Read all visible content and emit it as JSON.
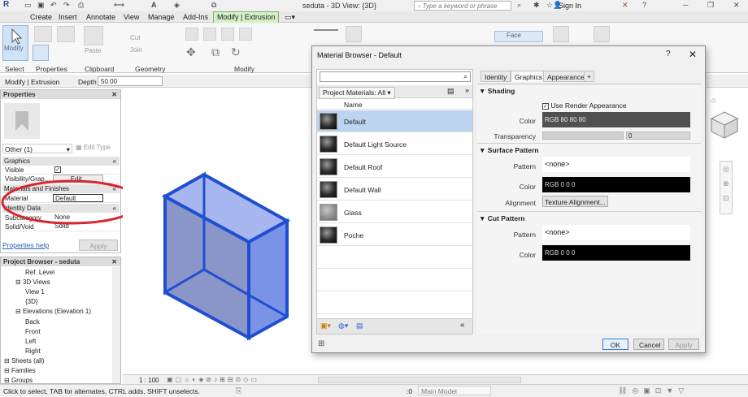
{
  "titlebar": {
    "title": "seduta - 3D View: {3D}",
    "search_placeholder": "Type a keyword or phrase",
    "sign_in": "Sign In"
  },
  "tabs": [
    {
      "label": "Create"
    },
    {
      "label": "Insert"
    },
    {
      "label": "Annotate"
    },
    {
      "label": "View"
    },
    {
      "label": "Manage"
    },
    {
      "label": "Add-Ins"
    },
    {
      "label": "Modify | Extrusion"
    }
  ],
  "ribbon": {
    "modify_label": "Modify",
    "select_label": "Select",
    "panels": [
      "Properties",
      "Clipboard",
      "Geometry",
      "Modify"
    ],
    "paste_label": "Paste",
    "cut_label": "Cut",
    "join_label": "Join",
    "face_label": "Face"
  },
  "optionsbar": {
    "context": "Modify | Extrusion",
    "depth_label": "Depth",
    "depth_value": "50.00"
  },
  "properties": {
    "title": "Properties",
    "type_selector": "Other (1)",
    "edit_type": "Edit Type",
    "sections": {
      "graphics": "Graphics",
      "materials": "Materials and Finishes",
      "identity": "Identity Data"
    },
    "rows": {
      "visible": "Visible",
      "visibility": "Visibility/Grap...",
      "visibility_btn": "Edit...",
      "material": "Material",
      "material_value": "Default",
      "subcategory": "Subcategory",
      "subcategory_value": "None",
      "solidvoid": "Solid/Void",
      "solidvoid_value": "Solid"
    },
    "help": "Properties help",
    "apply": "Apply"
  },
  "project_browser": {
    "title": "Project Browser - seduta",
    "nodes": [
      {
        "label": "Ref. Level",
        "level": 3
      },
      {
        "label": "3D Views",
        "level": 2
      },
      {
        "label": "View 1",
        "level": 3
      },
      {
        "label": "{3D}",
        "level": 3
      },
      {
        "label": "Elevations (Elevation 1)",
        "level": 2
      },
      {
        "label": "Back",
        "level": 3
      },
      {
        "label": "Front",
        "level": 3
      },
      {
        "label": "Left",
        "level": 3
      },
      {
        "label": "Right",
        "level": 3
      },
      {
        "label": "Sheets (all)",
        "level": 1
      },
      {
        "label": "Families",
        "level": 1
      },
      {
        "label": "Groups",
        "level": 1
      }
    ]
  },
  "viewcontrol": {
    "scale": "1 : 100"
  },
  "status": {
    "message": "Click to select, TAB for alternates, CTRL adds, SHIFT unselects.",
    "zero": ":0",
    "model": "Main Model"
  },
  "dialog": {
    "title": "Material Browser - Default",
    "help": "?",
    "close": "✕",
    "filter": "Project Materials: All",
    "col_name": "Name",
    "materials": [
      {
        "name": "Default",
        "selected": true,
        "swatch": "dark"
      },
      {
        "name": "Default Light Source",
        "selected": false,
        "swatch": "dark"
      },
      {
        "name": "Default Roof",
        "selected": false,
        "swatch": "dark"
      },
      {
        "name": "Default Wall",
        "selected": false,
        "swatch": "dark"
      },
      {
        "name": "Glass",
        "selected": false,
        "swatch": "gray"
      },
      {
        "name": "Poche",
        "selected": false,
        "swatch": "dark"
      }
    ],
    "tabs": [
      "Identity",
      "Graphics",
      "Appearance"
    ],
    "shading": {
      "heading": "Shading",
      "use_render": "Use Render Appearance",
      "color_label": "Color",
      "color_value": "RGB 80 80 80",
      "transparency_label": "Transparency",
      "transparency_value": "0"
    },
    "surface": {
      "heading": "Surface Pattern",
      "pattern_label": "Pattern",
      "pattern_value": "<none>",
      "color_label": "Color",
      "color_value": "RGB 0 0 0",
      "alignment_label": "Alignment",
      "alignment_btn": "Texture Alignment..."
    },
    "cut": {
      "heading": "Cut Pattern",
      "pattern_label": "Pattern",
      "pattern_value": "<none>",
      "color_label": "Color",
      "color_value": "RGB 0 0 0"
    },
    "buttons": {
      "ok": "OK",
      "cancel": "Cancel",
      "apply": "Apply"
    }
  },
  "colors": {
    "selection": "#bcd4ef",
    "context_tab": "#d4f0c6",
    "box_edge": "#1f4fd1",
    "annotation_circle": "#d9262c"
  }
}
